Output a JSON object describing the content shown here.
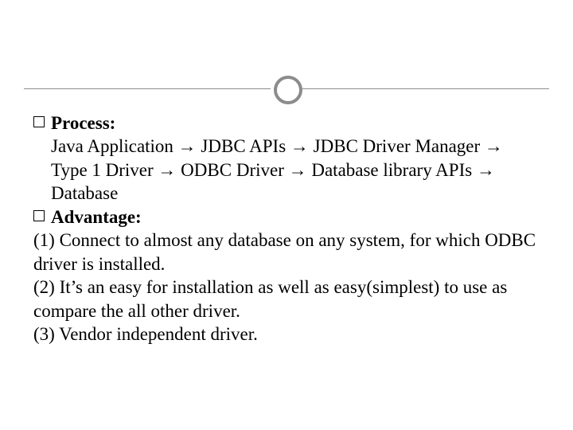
{
  "headings": {
    "process": "Process:",
    "advantage": "Advantage:"
  },
  "process_body": "Java Application  → JDBC APIs    → JDBC Driver Manager →  Type 1 Driver  →  ODBC Driver  → Database library APIs → Database",
  "advantages": {
    "a1": "(1)   Connect to almost any database on any system, for which ODBC driver is installed.",
    "a2": "(2)   It’s an easy for installation as well as easy(simplest) to use as compare the all other driver.",
    "a3": "(3) Vendor independent driver."
  }
}
